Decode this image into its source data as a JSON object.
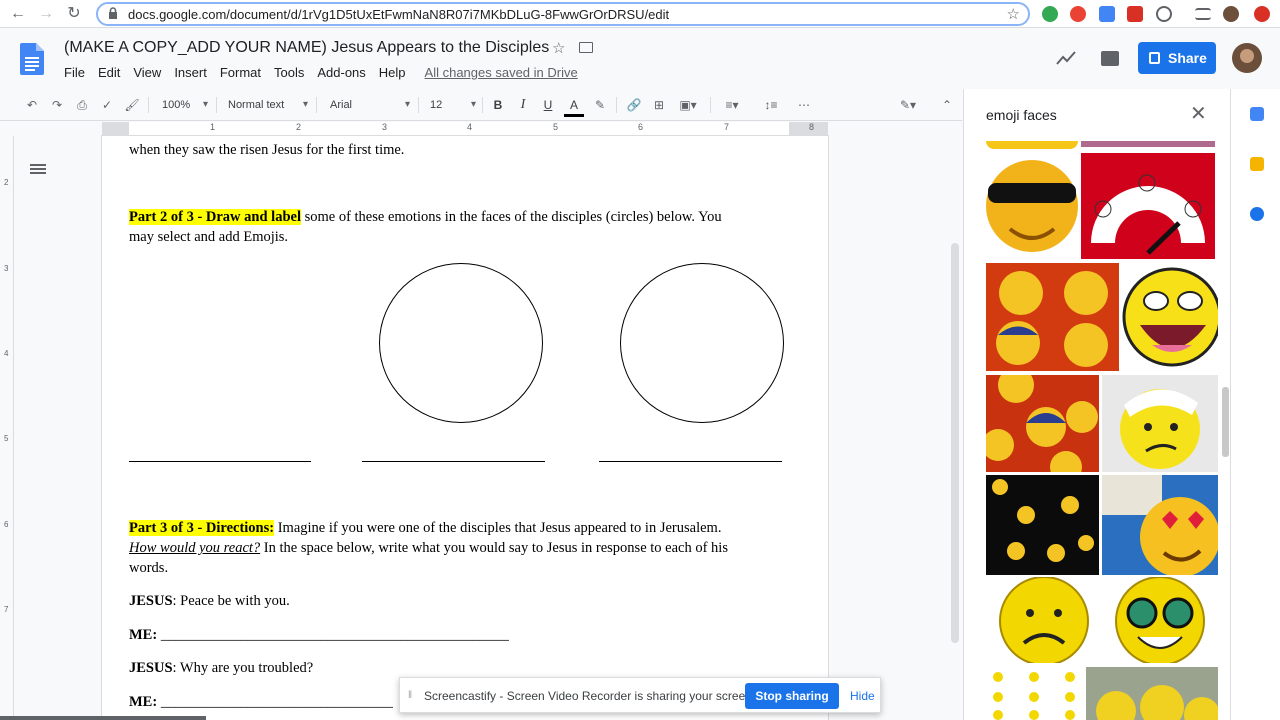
{
  "browser": {
    "url": "docs.google.com/document/d/1rVg1D5tUxEtFwmNaN8R07i7MKbDLuG-8FwwGrOrDRSU/edit"
  },
  "header": {
    "title": "(MAKE A COPY_ADD YOUR NAME) Jesus Appears to the Disciples",
    "menus": [
      "File",
      "Edit",
      "View",
      "Insert",
      "Format",
      "Tools",
      "Add-ons",
      "Help"
    ],
    "save_status": "All changes saved in Drive",
    "share_label": "Share"
  },
  "toolbar": {
    "zoom": "100%",
    "style": "Normal text",
    "font": "Arial",
    "size": "12",
    "bold": "B",
    "italic": "I",
    "underline": "U",
    "text_color_letter": "A"
  },
  "ruler": {
    "marks": [
      "1",
      "2",
      "3",
      "4",
      "5",
      "6",
      "7",
      "8"
    ],
    "vmarks": [
      "2",
      "3",
      "4",
      "5",
      "6",
      "7"
    ]
  },
  "doc": {
    "line0_visible": "when they saw the risen Jesus for the first time.",
    "part2_label": "Part 2 of 3 - Draw and label",
    "part2_text_a": " some of these emotions in the faces of the disciples (circles) below. You",
    "part2_text_b": "may select and add Emojis.",
    "part3_label": "Part 3 of 3 - Directions:",
    "part3_text_a": " Imagine if you were one of the disciples that Jesus appeared to in Jerusalem.",
    "part3_italic": "How would you react?",
    "part3_text_b": " In the space below, write what you would say to Jesus in response to each of his",
    "part3_text_c": "words.",
    "jesus_label": "JESUS",
    "jesus1": ": Peace be with you.",
    "me_label": "ME:",
    "me_blank": " ________________________________________________",
    "jesus2": ": Why are you troubled?",
    "me2_blank": " ________________________________"
  },
  "explore": {
    "query": "emoji faces"
  },
  "banner": {
    "message": "Screencastify - Screen Video Recorder is sharing your screen.",
    "stop_label": "Stop sharing",
    "hide_label": "Hide"
  },
  "colors": {
    "accent": "#1a73e8",
    "highlight": "#ffff00"
  }
}
